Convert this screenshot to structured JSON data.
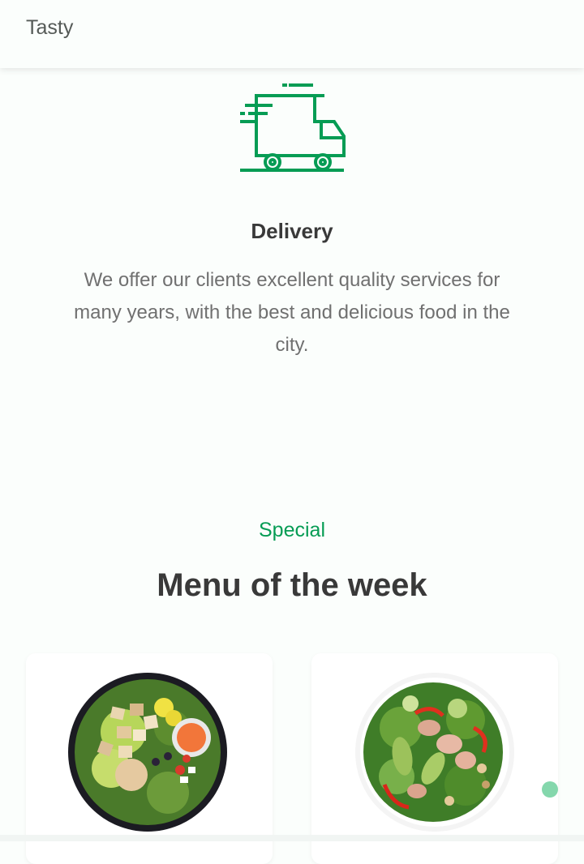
{
  "header": {
    "logo": "Tasty"
  },
  "delivery": {
    "icon": "delivery-truck-icon",
    "title": "Delivery",
    "description": "We offer our clients excellent quality services for many years, with the best and delicious food in the city."
  },
  "menu": {
    "subtitle": "Special",
    "title": "Menu of the week"
  },
  "colors": {
    "accent": "#069c54",
    "title": "#393939",
    "text": "#707070",
    "background": "#fbfefc",
    "scroll_button": "#84d7ac"
  }
}
